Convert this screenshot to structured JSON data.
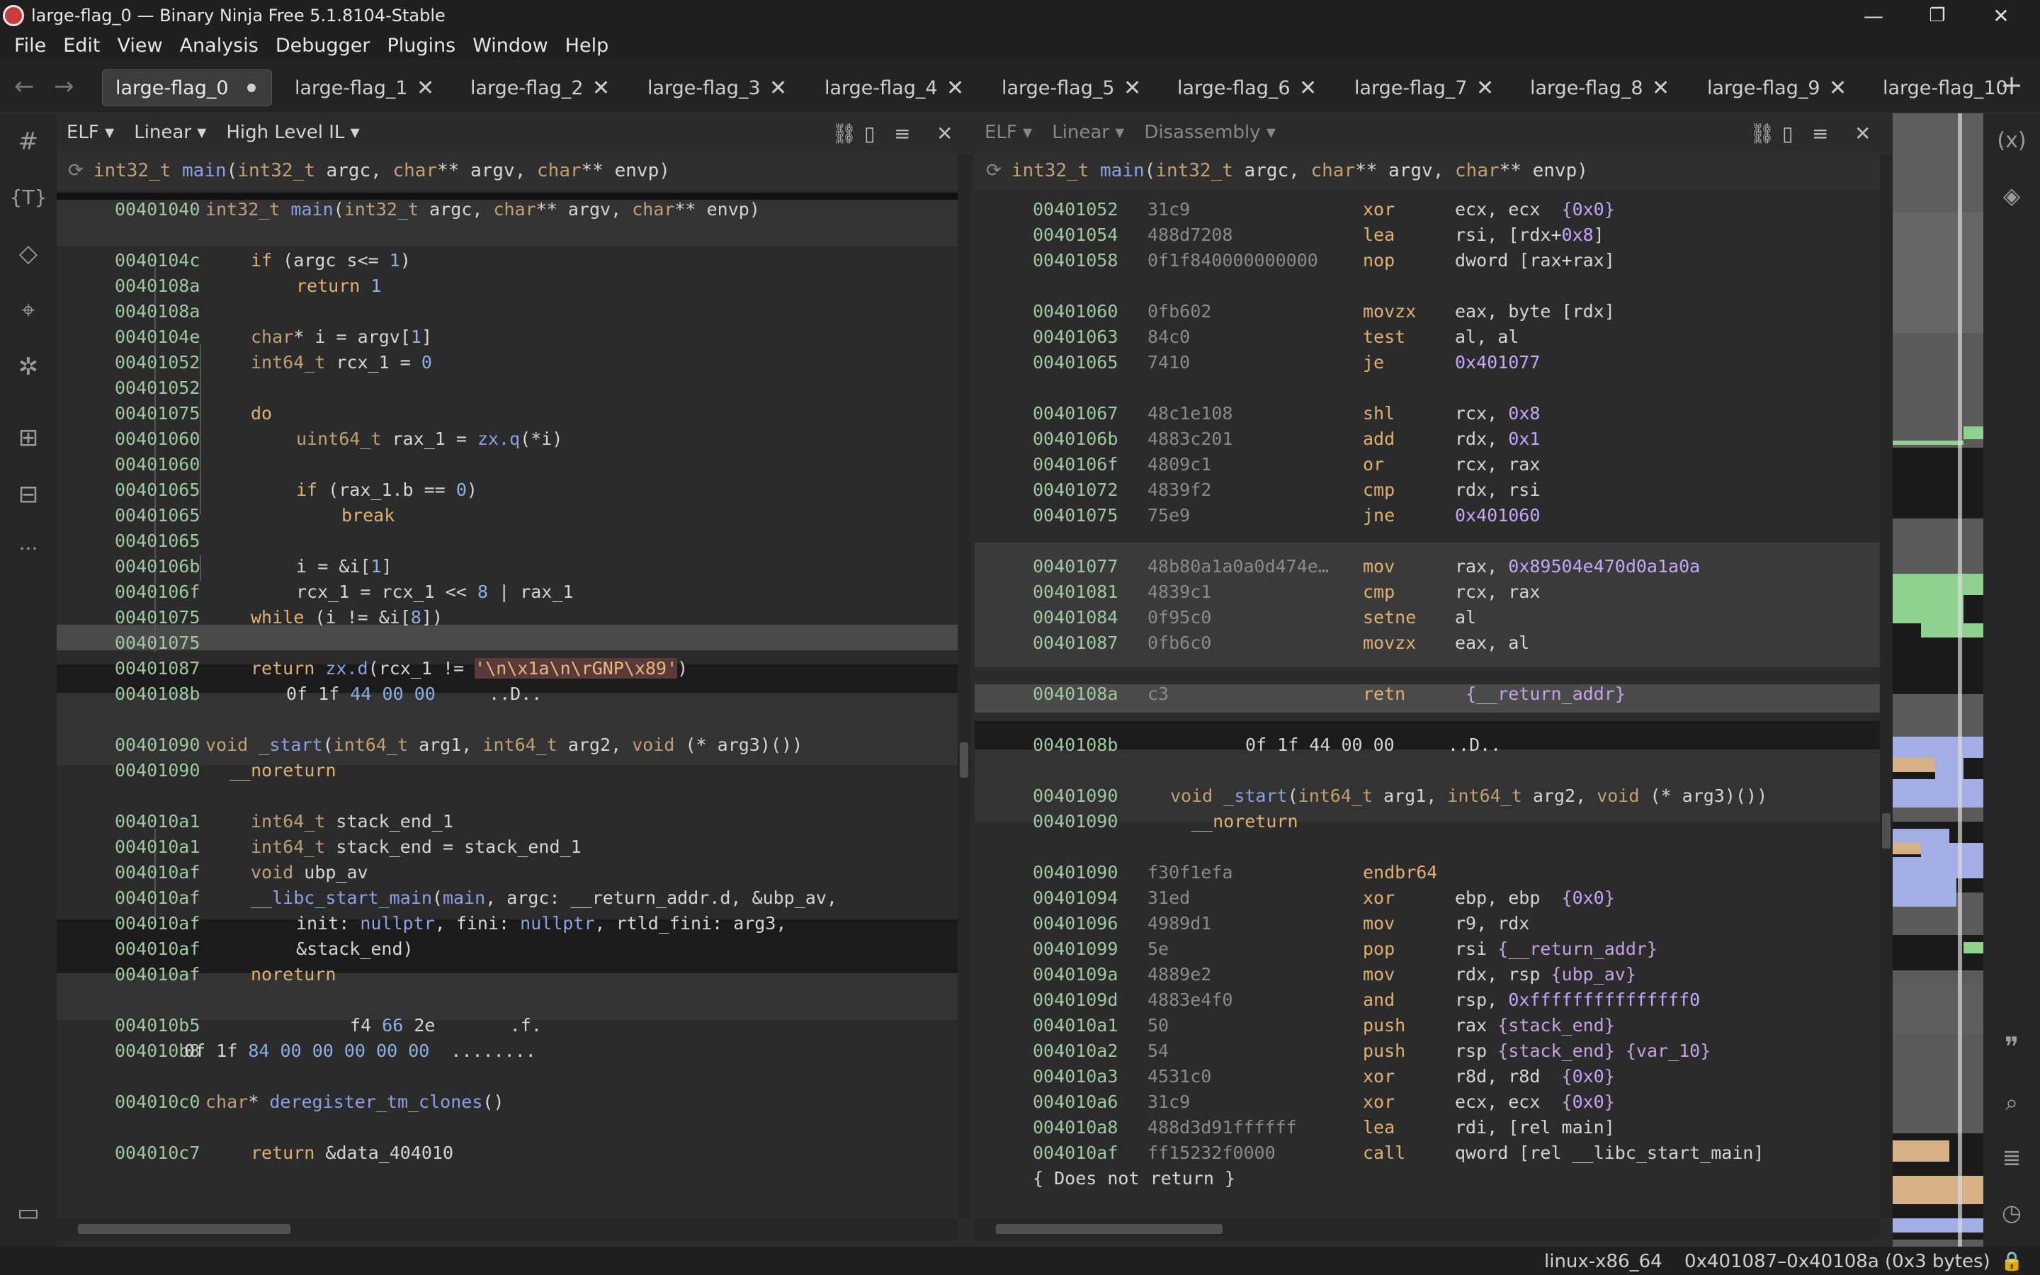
{
  "window": {
    "title": "large-flag_0 — Binary Ninja Free 5.1.8104-Stable",
    "minimize": "—",
    "maximize": "❐",
    "close": "✕"
  },
  "menu": [
    "File",
    "Edit",
    "View",
    "Analysis",
    "Debugger",
    "Plugins",
    "Window",
    "Help"
  ],
  "tabs": [
    "large-flag_0",
    "large-flag_1",
    "large-flag_2",
    "large-flag_3",
    "large-flag_4",
    "large-flag_5",
    "large-flag_6",
    "large-flag_7",
    "large-flag_8",
    "large-flag_9",
    "large-flag_10"
  ],
  "tab_close": "✕",
  "new_tab": "+",
  "nav": {
    "back": "←",
    "forward": "→"
  },
  "left_pane": {
    "view_type": "ELF ▾",
    "layout": "Linear ▾",
    "il": "High Level IL ▾",
    "signature": "int32_t main(int32_t argc, char** argv, char** envp)"
  },
  "right_pane": {
    "view_type": "ELF ▾",
    "layout": "Linear ▾",
    "il": "Disassembly ▾",
    "signature": "int32_t main(int32_t argc, char** argv, char** envp)"
  },
  "hlil_lines": [
    {
      "addr": "00401040",
      "text": "int32_t main(int32_t argc, char** argv, char** envp)"
    },
    {
      "addr": "0040104c",
      "text": "if (argc s<= 1)"
    },
    {
      "addr": "0040108a",
      "text": "return 1"
    },
    {
      "addr": "0040108a",
      "text": ""
    },
    {
      "addr": "0040104e",
      "text": "char* i = argv[1]"
    },
    {
      "addr": "00401052",
      "text": "int64_t rcx_1 = 0"
    },
    {
      "addr": "00401052",
      "text": ""
    },
    {
      "addr": "00401075",
      "text": "do"
    },
    {
      "addr": "00401060",
      "text": "uint64_t rax_1 = zx.q(*i)"
    },
    {
      "addr": "00401060",
      "text": ""
    },
    {
      "addr": "00401065",
      "text": "if (rax_1.b == 0)"
    },
    {
      "addr": "00401065",
      "text": "break"
    },
    {
      "addr": "00401065",
      "text": ""
    },
    {
      "addr": "0040106b",
      "text": "i = &i[1]"
    },
    {
      "addr": "0040106f",
      "text": "rcx_1 = rcx_1 << 8 | rax_1"
    },
    {
      "addr": "00401075",
      "text": "while (i != &i[8])"
    },
    {
      "addr": "00401075",
      "text": ""
    },
    {
      "addr": "00401087",
      "text": "return zx.d(rcx_1 != '\\n\\x1a\\n\\rGNP\\x89')"
    },
    {
      "addr": "0040108b",
      "text": "0f 1f 44 00 00     ..D.."
    },
    {
      "addr": "00401090",
      "text": "void _start(int64_t arg1, int64_t arg2, void (* arg3)())"
    },
    {
      "addr": "00401090",
      "text": "__noreturn"
    },
    {
      "addr": "004010a1",
      "text": "int64_t stack_end_1"
    },
    {
      "addr": "004010a1",
      "text": "int64_t stack_end = stack_end_1"
    },
    {
      "addr": "004010af",
      "text": "void ubp_av"
    },
    {
      "addr": "004010af",
      "text": "__libc_start_main(main, argc: __return_addr.d, &ubp_av,"
    },
    {
      "addr": "004010af",
      "text": "init: nullptr, fini: nullptr, rtld_fini: arg3,"
    },
    {
      "addr": "004010af",
      "text": "&stack_end)"
    },
    {
      "addr": "004010af",
      "text": "noreturn"
    },
    {
      "addr": "004010b5",
      "text": "f4 66 2e       .f."
    },
    {
      "addr": "004010b8",
      "text": "0f 1f 84 00 00 00 00 00  ........"
    },
    {
      "addr": "004010c0",
      "text": "char* deregister_tm_clones()"
    },
    {
      "addr": "004010c7",
      "text": "return &data_404010"
    }
  ],
  "asm_lines": [
    {
      "addr": "00401052",
      "bytes": "31c9",
      "mn": "xor",
      "ops": "ecx, ecx  {0x0}"
    },
    {
      "addr": "00401054",
      "bytes": "488d7208",
      "mn": "lea",
      "ops": "rsi, [rdx+0x8]"
    },
    {
      "addr": "00401058",
      "bytes": "0f1f840000000000",
      "mn": "nop",
      "ops": "dword [rax+rax]"
    },
    {
      "addr": "00401060",
      "bytes": "0fb602",
      "mn": "movzx",
      "ops": "eax, byte [rdx]"
    },
    {
      "addr": "00401063",
      "bytes": "84c0",
      "mn": "test",
      "ops": "al, al"
    },
    {
      "addr": "00401065",
      "bytes": "7410",
      "mn": "je",
      "ops": "0x401077"
    },
    {
      "addr": "00401067",
      "bytes": "48c1e108",
      "mn": "shl",
      "ops": "rcx, 0x8"
    },
    {
      "addr": "0040106b",
      "bytes": "4883c201",
      "mn": "add",
      "ops": "rdx, 0x1"
    },
    {
      "addr": "0040106f",
      "bytes": "4809c1",
      "mn": "or",
      "ops": "rcx, rax"
    },
    {
      "addr": "00401072",
      "bytes": "4839f2",
      "mn": "cmp",
      "ops": "rdx, rsi"
    },
    {
      "addr": "00401075",
      "bytes": "75e9",
      "mn": "jne",
      "ops": "0x401060"
    },
    {
      "addr": "00401077",
      "bytes": "48b80a1a0a0d474e…",
      "mn": "mov",
      "ops": "rax, 0x89504e470d0a1a0a"
    },
    {
      "addr": "00401081",
      "bytes": "4839c1",
      "mn": "cmp",
      "ops": "rcx, rax"
    },
    {
      "addr": "00401084",
      "bytes": "0f95c0",
      "mn": "setne",
      "ops": "al"
    },
    {
      "addr": "00401087",
      "bytes": "0fb6c0",
      "mn": "movzx",
      "ops": "eax, al"
    },
    {
      "addr": "0040108a",
      "bytes": "c3",
      "mn": "retn",
      "ops": " {__return_addr}"
    },
    {
      "addr": "0040108b",
      "bytes": "",
      "mn": "",
      "ops": "0f 1f 44 00 00     ..D.."
    },
    {
      "addr": "00401090",
      "bytes": "",
      "mn": "",
      "ops": "void _start(int64_t arg1, int64_t arg2, void (* arg3)())"
    },
    {
      "addr": "00401090",
      "bytes": "",
      "mn": "",
      "ops": "__noreturn"
    },
    {
      "addr": "00401090",
      "bytes": "f30f1efa",
      "mn": "endbr64",
      "ops": ""
    },
    {
      "addr": "00401094",
      "bytes": "31ed",
      "mn": "xor",
      "ops": "ebp, ebp  {0x0}"
    },
    {
      "addr": "00401096",
      "bytes": "4989d1",
      "mn": "mov",
      "ops": "r9, rdx"
    },
    {
      "addr": "00401099",
      "bytes": "5e",
      "mn": "pop",
      "ops": "rsi {__return_addr}"
    },
    {
      "addr": "0040109a",
      "bytes": "4889e2",
      "mn": "mov",
      "ops": "rdx, rsp {ubp_av}"
    },
    {
      "addr": "0040109d",
      "bytes": "4883e4f0",
      "mn": "and",
      "ops": "rsp, 0xfffffffffffffff0"
    },
    {
      "addr": "004010a1",
      "bytes": "50",
      "mn": "push",
      "ops": "rax {stack_end}"
    },
    {
      "addr": "004010a2",
      "bytes": "54",
      "mn": "push",
      "ops": "rsp {stack_end} {var_10}"
    },
    {
      "addr": "004010a3",
      "bytes": "4531c0",
      "mn": "xor",
      "ops": "r8d, r8d  {0x0}"
    },
    {
      "addr": "004010a6",
      "bytes": "31c9",
      "mn": "xor",
      "ops": "ecx, ecx  {0x0}"
    },
    {
      "addr": "004010a8",
      "bytes": "488d3d91ffffff",
      "mn": "lea",
      "ops": "rdi, [rel main]"
    },
    {
      "addr": "004010af",
      "bytes": "ff15232f0000",
      "mn": "call",
      "ops": "qword [rel __libc_start_main]"
    },
    {
      "addr": "",
      "bytes": "",
      "mn": "",
      "ops": "{ Does not return }"
    }
  ],
  "status": {
    "platform": "linux-x86_64",
    "selection": "0x401087–0x40108a (0x3 bytes)"
  },
  "colors": {
    "address": "#9ec9a0",
    "keyword": "#e0b070",
    "function": "#8aa0e6",
    "string_bg": "#5a3a38",
    "highlight_line": "#4a4a4a"
  }
}
